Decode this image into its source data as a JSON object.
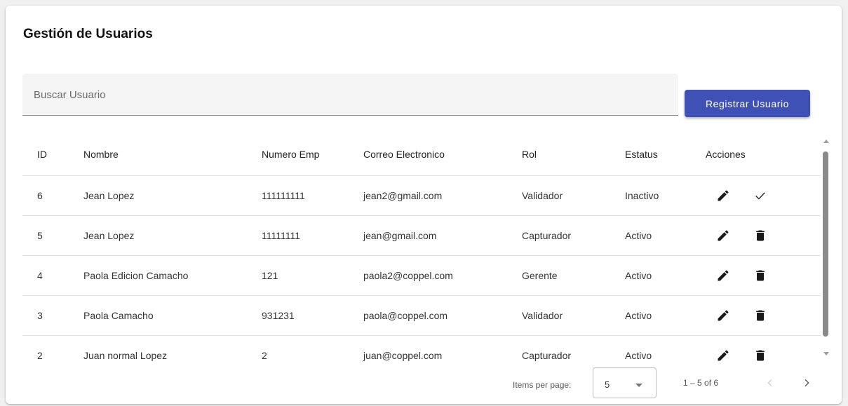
{
  "page": {
    "title": "Gestión de Usuarios"
  },
  "search": {
    "placeholder": "Buscar Usuario",
    "value": ""
  },
  "register_button": {
    "label": "Registrar Usuario"
  },
  "colors": {
    "primary": "#3f51b5",
    "icon": "#1a1a1a",
    "divider": "#e0e0e0"
  },
  "table": {
    "headers": {
      "id": "ID",
      "nombre": "Nombre",
      "numero_emp": "Numero Emp",
      "correo": "Correo Electronico",
      "rol": "Rol",
      "estatus": "Estatus",
      "acciones": "Acciones"
    },
    "rows": [
      {
        "id": "6",
        "nombre": "Jean Lopez",
        "numero_emp": "111111111",
        "correo": "jean2@gmail.com",
        "rol": "Validador",
        "estatus": "Inactivo",
        "actions": [
          "edit-icon",
          "check-icon"
        ]
      },
      {
        "id": "5",
        "nombre": "Jean Lopez",
        "numero_emp": "11111111",
        "correo": "jean@gmail.com",
        "rol": "Capturador",
        "estatus": "Activo",
        "actions": [
          "edit-icon",
          "delete-icon"
        ]
      },
      {
        "id": "4",
        "nombre": "Paola Edicion Camacho",
        "numero_emp": "121",
        "correo": "paola2@coppel.com",
        "rol": "Gerente",
        "estatus": "Activo",
        "actions": [
          "edit-icon",
          "delete-icon"
        ]
      },
      {
        "id": "3",
        "nombre": "Paola Camacho",
        "numero_emp": "931231",
        "correo": "paola@coppel.com",
        "rol": "Validador",
        "estatus": "Activo",
        "actions": [
          "edit-icon",
          "delete-icon"
        ]
      },
      {
        "id": "2",
        "nombre": "Juan normal Lopez",
        "numero_emp": "2",
        "correo": "juan@coppel.com",
        "rol": "Capturador",
        "estatus": "Activo",
        "actions": [
          "edit-icon",
          "delete-icon"
        ]
      }
    ]
  },
  "paginator": {
    "items_per_page_label": "Items per page:",
    "items_per_page_value": "5",
    "range_label": "1 – 5 of 6",
    "prev_icon": "chevron-left-icon",
    "next_icon": "chevron-right-icon"
  }
}
